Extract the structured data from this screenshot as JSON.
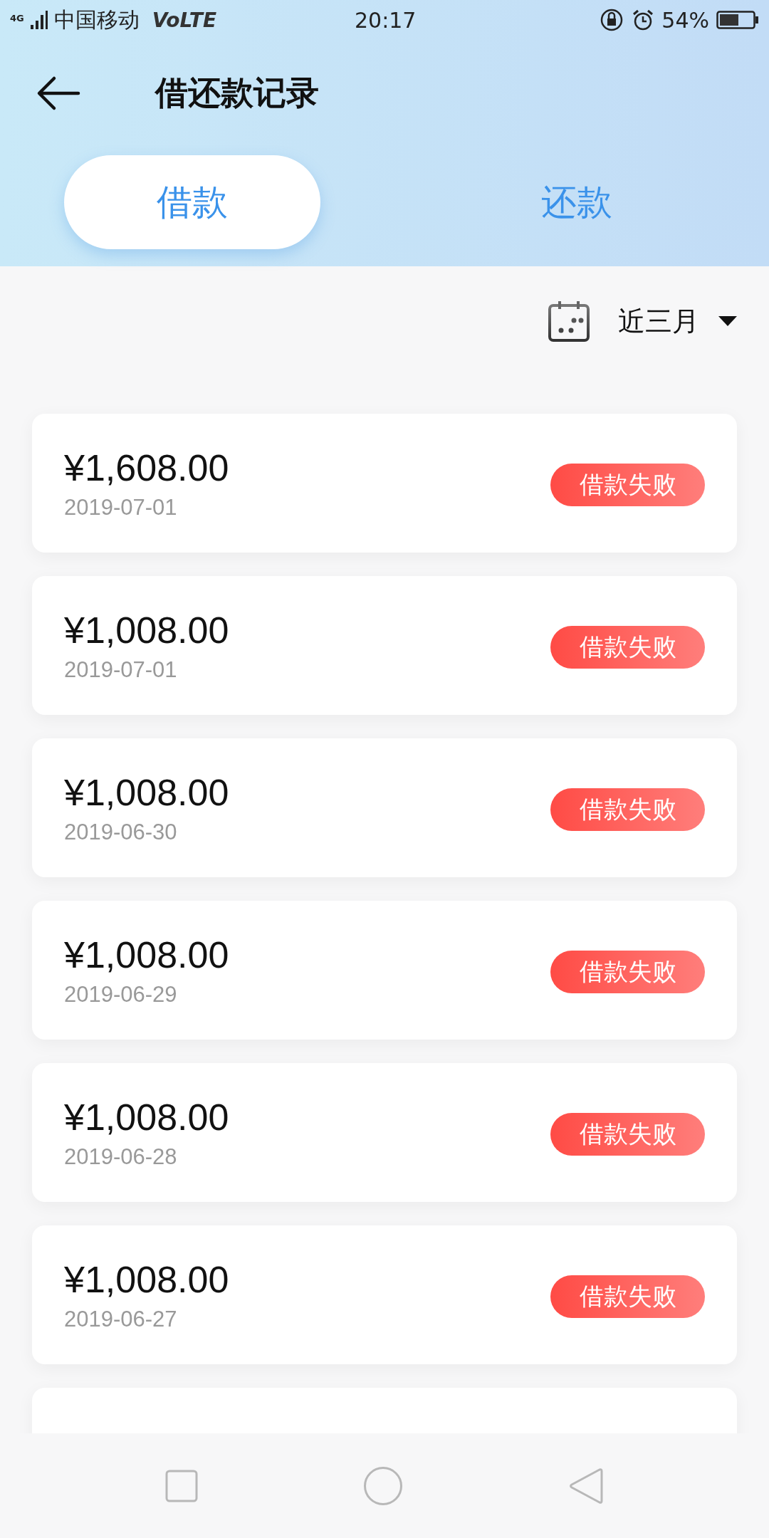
{
  "status_bar": {
    "network_type": "4G",
    "carrier": "中国移动",
    "network": "VoLTE",
    "time": "20:17",
    "battery": "54%"
  },
  "header": {
    "title": "借还款记录",
    "tabs": [
      {
        "label": "借款",
        "selected": true
      },
      {
        "label": "还款",
        "selected": false
      }
    ]
  },
  "filter": {
    "label": "近三月"
  },
  "records": [
    {
      "kind": "record",
      "amount": "¥1,608.00",
      "date": "2019-07-01",
      "status": "借款失败"
    },
    {
      "kind": "record",
      "amount": "¥1,008.00",
      "date": "2019-07-01",
      "status": "借款失败"
    },
    {
      "kind": "record",
      "amount": "¥1,008.00",
      "date": "2019-06-30",
      "status": "借款失败"
    },
    {
      "kind": "record",
      "amount": "¥1,008.00",
      "date": "2019-06-29",
      "status": "借款失败"
    },
    {
      "kind": "record",
      "amount": "¥1,008.00",
      "date": "2019-06-28",
      "status": "借款失败"
    },
    {
      "kind": "record",
      "amount": "¥1,008.00",
      "date": "2019-06-27",
      "status": "借款失败"
    },
    {
      "kind": "partial"
    }
  ]
}
